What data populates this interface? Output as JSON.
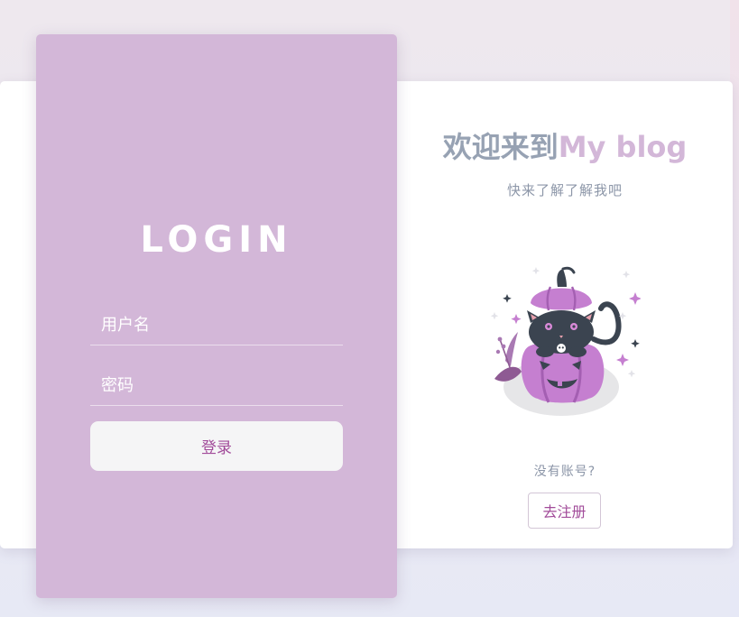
{
  "login": {
    "title": "LOGIN",
    "username_placeholder": "用户名",
    "password_placeholder": "密码",
    "submit_label": "登录"
  },
  "welcome": {
    "title_prefix": "欢迎来到",
    "title_brand": "My blog",
    "subtitle": "快来了解了解我吧",
    "illustration": "cat-in-pumpkin-illustration",
    "no_account_text": "没有账号?",
    "register_label": "去注册"
  },
  "colors": {
    "login_panel": "#d3b7d8",
    "accent_text": "#a24c9a",
    "muted_text": "#97a2b3",
    "card_background": "#ffffff"
  }
}
